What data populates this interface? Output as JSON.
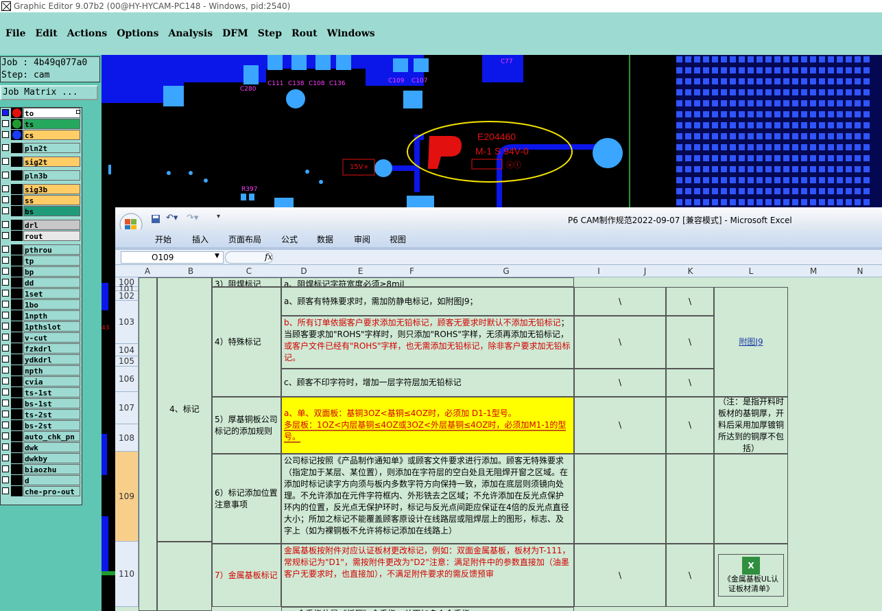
{
  "window": {
    "title": "Graphic Editor 9.07b2 (00@HY-HYCAM-PC148 - Windows, pid:2540)"
  },
  "menu": [
    "File",
    "Edit",
    "Actions",
    "Options",
    "Analysis",
    "DFM",
    "Step",
    "Rout",
    "Windows"
  ],
  "job": {
    "job_line": "Job : 4b49q077a0",
    "step_line": "Step: cam",
    "matrix_button": "Job Matrix ..."
  },
  "layers": [
    {
      "name": "to",
      "color": "#e31010",
      "active": true
    },
    {
      "name": "ts",
      "color": "#1f9b2f"
    },
    {
      "name": "cs",
      "color": "#1a3cff"
    },
    {
      "name": "pln2t"
    },
    {
      "name": "sig2t"
    },
    {
      "name": "pln3b"
    },
    {
      "name": "sig3b"
    },
    {
      "name": "ss"
    },
    {
      "name": "bs"
    },
    {
      "name": "drl"
    },
    {
      "name": "rout"
    },
    {
      "name": "pthrou"
    },
    {
      "name": "tp"
    },
    {
      "name": "bp"
    },
    {
      "name": "dd"
    },
    {
      "name": "1set"
    },
    {
      "name": "1bo"
    },
    {
      "name": "1npth"
    },
    {
      "name": "1pthslot"
    },
    {
      "name": "v-cut"
    },
    {
      "name": "fzkdrl"
    },
    {
      "name": "ydkdrl"
    },
    {
      "name": "npth"
    },
    {
      "name": "cvia"
    },
    {
      "name": "ts-1st"
    },
    {
      "name": "bs-1st"
    },
    {
      "name": "ts-2st"
    },
    {
      "name": "bs-2st"
    },
    {
      "name": "auto_chk_pn"
    },
    {
      "name": "dwk"
    },
    {
      "name": "dwkby"
    },
    {
      "name": "biaozhu"
    },
    {
      "name": "d"
    },
    {
      "name": "che-pro-out"
    }
  ],
  "pcb": {
    "labels": [
      "C280",
      "C111",
      "C138",
      "C108",
      "C136",
      "C109",
      "C107",
      "C77",
      "15V+",
      "R397"
    ],
    "mark_code": "E204460",
    "mark_rating": "M-1 S 94V-0"
  },
  "excel": {
    "title": "P6 CAM制作规范2022-09-07  [兼容模式] - Microsoft Excel",
    "tabs": [
      "开始",
      "插入",
      "页面布局",
      "公式",
      "数据",
      "审阅",
      "视图"
    ],
    "name_box": "O109",
    "fx": "fx",
    "columns": [
      "A",
      "B",
      "C",
      "D",
      "E",
      "F",
      "G",
      "I",
      "J",
      "K",
      "L",
      "M",
      "N"
    ],
    "rows": [
      "100",
      "101",
      "102",
      "103",
      "104",
      "105",
      "106",
      "107",
      "108",
      "109",
      "110"
    ],
    "b_section": "4、标记",
    "row100_c": "3）阻焊标记",
    "row100_d": "a、阻焊标记字符宽度必须≥8mil",
    "c_special": "4）特殊标记",
    "d101": "a、顾客有特殊要求时，需加防静电标记，如附图J9；",
    "d103_a": "b、所有订单依据客户要求添加无铅标记，顾客无要求时默认不添加无铅标记",
    "d103_b": "；当顾客要求加\"ROHS\"字样时，则只添加\"ROHS\"字样，无须再添加无铅标记，",
    "d103_c": "或客户文件已经有\"ROHS\"字样，也无需添加无铅标记，除非客户要求加无铅标记。",
    "d105": "c、顾客不印字符时，增加一层字符层加无铅标记",
    "l_link": "附图J9",
    "c_thick": "5）厚基铜板公司标记的添加规则",
    "d107_a": "a、单、双面板：基铜3OZ<基铜≤4OZ时，必须加 D1-1型号。",
    "d107_b": "多层板：1OZ<内层基铜≤4OZ或3OZ<外层基铜≤4OZ时，必须加M1-1的型号。",
    "l_note": "（注：是指开料时板材的基铜厚，开料后采用加厚镀铜所达到的铜厚不包括）",
    "c_attention": "6）标记添加位置注意事项",
    "d109": "公司标记按照《产品制作通知单》或顾客文件要求进行添加。顾客无特殊要求（指定加于某层、某位置），则添加在字符层的空白处且无阻焊开窗之区域。在添加时标记读字方向须与板内多数字符方向保持一致，添加在底层则须镜向处理。不允许添加在元件字符框内、外形铣去之区域；不允许添加在反光点保护环内的位置，反光点无保护环时，标记与反光点间距应保证在4倍的反光点直径大小；所加之标记不能覆盖顾客原设计在线路层或阻焊层上的图形，标志、及字上（如为裸铜板不允许将标记添加在线路上）",
    "c_metal": "7）金属基板标记",
    "d110_a": "金属基板按附件对应认证板材更改标记，例如：双面金属基板，板材为T-111，常规标记为\"D1\"，需按附件更改为\"D2\"",
    "d110_b": "注意：满足附件中的参数直接加（油墨客户无要求时，也直接加），不满足附件要求的需反馈预审",
    "l_attach": "《金属基板UL认证板材清单》",
    "l_attach_icon": "excel-file-icon",
    "bs": "\\",
    "d_next": "a、金手指位是《板厚》金手指，单面加多个金手指......"
  }
}
